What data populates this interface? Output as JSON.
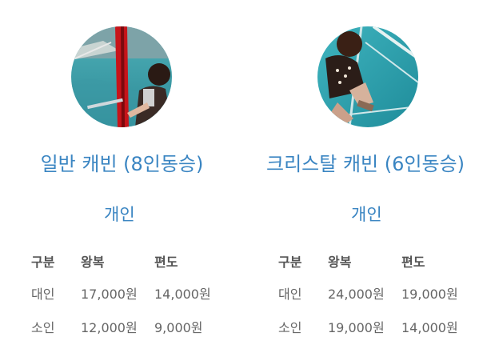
{
  "cabins": [
    {
      "title": "일반 캐빈 (8인동승)",
      "photo_icon": "cabin-photo-general",
      "type_label": "개인",
      "table": {
        "headers": [
          "구분",
          "왕복",
          "편도"
        ],
        "rows": [
          [
            "대인",
            "17,000원",
            "14,000원"
          ],
          [
            "소인",
            "12,000원",
            "9,000원"
          ]
        ]
      }
    },
    {
      "title": "크리스탈 캐빈 (6인동승)",
      "photo_icon": "cabin-photo-crystal",
      "type_label": "개인",
      "table": {
        "headers": [
          "구분",
          "왕복",
          "편도"
        ],
        "rows": [
          [
            "대인",
            "24,000원",
            "19,000원"
          ],
          [
            "소인",
            "19,000원",
            "14,000원"
          ]
        ]
      }
    }
  ],
  "colors": {
    "accent": "#3a85c2",
    "text": "#555555"
  }
}
